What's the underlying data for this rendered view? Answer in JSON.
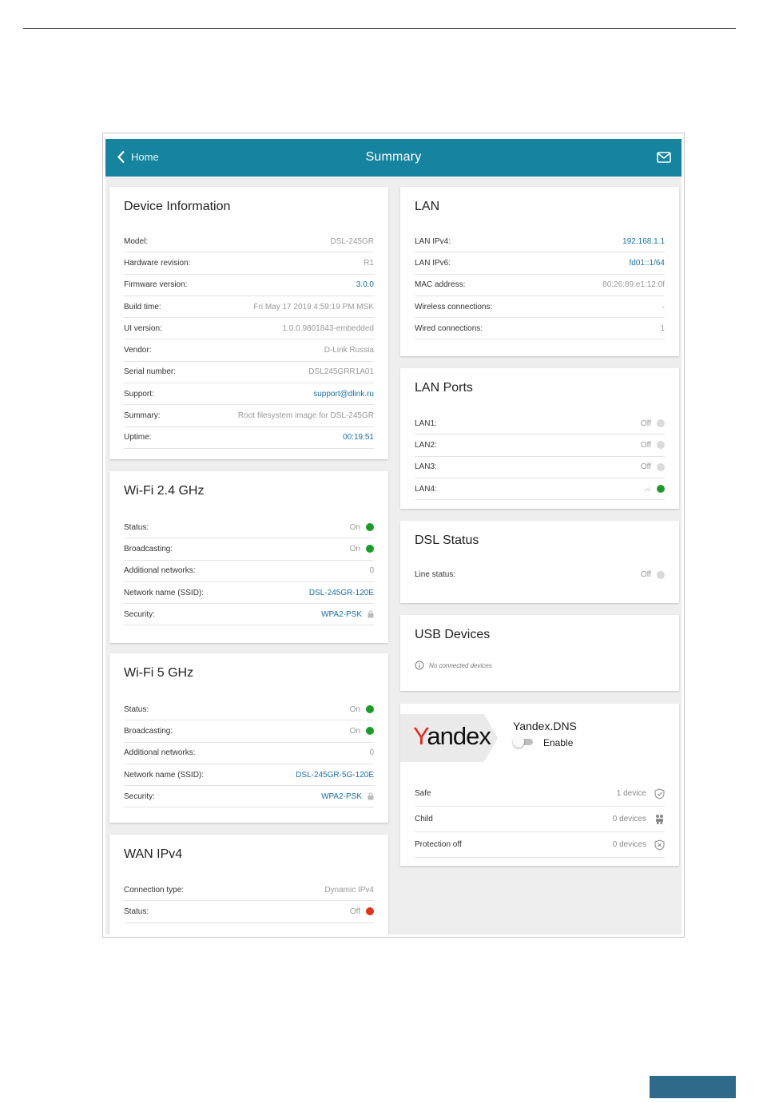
{
  "header": {
    "home_label": "Home",
    "title": "Summary"
  },
  "device_info": {
    "title": "Device Information",
    "rows": [
      {
        "label": "Model:",
        "value": "DSL-245GR"
      },
      {
        "label": "Hardware revision:",
        "value": "R1"
      },
      {
        "label": "Firmware version:",
        "value": "3.0.0"
      },
      {
        "label": "Build time:",
        "value": "Fri May 17 2019 4:59:19 PM MSK"
      },
      {
        "label": "UI version:",
        "value": "1.0.0.9801843-embedded"
      },
      {
        "label": "Vendor:",
        "value": "D-Link Russia"
      },
      {
        "label": "Serial number:",
        "value": "DSL245GRR1A01"
      },
      {
        "label": "Support:",
        "value": "support@dlink.ru"
      },
      {
        "label": "Summary:",
        "value": "Root filesystem image for DSL-245GR"
      },
      {
        "label": "Uptime:",
        "value": "00:19:51"
      }
    ]
  },
  "wifi24": {
    "title": "Wi-Fi 2.4 GHz",
    "rows": [
      {
        "label": "Status:",
        "value": "On"
      },
      {
        "label": "Broadcasting:",
        "value": "On"
      },
      {
        "label": "Additional networks:",
        "value": "0"
      },
      {
        "label": "Network name (SSID):",
        "value": "DSL-245GR-120E"
      },
      {
        "label": "Security:",
        "value": "WPA2-PSK"
      }
    ]
  },
  "wifi5": {
    "title": "Wi-Fi 5 GHz",
    "rows": [
      {
        "label": "Status:",
        "value": "On"
      },
      {
        "label": "Broadcasting:",
        "value": "On"
      },
      {
        "label": "Additional networks:",
        "value": "0"
      },
      {
        "label": "Network name (SSID):",
        "value": "DSL-245GR-5G-120E"
      },
      {
        "label": "Security:",
        "value": "WPA2-PSK"
      }
    ]
  },
  "wan": {
    "title": "WAN IPv4",
    "rows": [
      {
        "label": "Connection type:",
        "value": "Dynamic IPv4"
      },
      {
        "label": "Status:",
        "value": "Off"
      }
    ]
  },
  "lan": {
    "title": "LAN",
    "rows": [
      {
        "label": "LAN IPv4:",
        "value": "192.168.1.1"
      },
      {
        "label": "LAN IPv6:",
        "value": "fd01::1/64"
      },
      {
        "label": "MAC address:",
        "value": "80:26:89:e1:12:0f"
      },
      {
        "label": "Wireless connections:",
        "value": "-"
      },
      {
        "label": "Wired connections:",
        "value": "1"
      }
    ]
  },
  "lan_ports": {
    "title": "LAN Ports",
    "rows": [
      {
        "label": "LAN1:",
        "value": "Off"
      },
      {
        "label": "LAN2:",
        "value": "Off"
      },
      {
        "label": "LAN3:",
        "value": "Off"
      },
      {
        "label": "LAN4:",
        "value": ""
      }
    ]
  },
  "dsl": {
    "title": "DSL Status",
    "rows": [
      {
        "label": "Line status:",
        "value": "Off"
      }
    ]
  },
  "usb": {
    "title": "USB Devices",
    "note": "No connected devices"
  },
  "yandex": {
    "logo_y": "Y",
    "logo_rest": "andex",
    "title": "Yandex.DNS",
    "toggle_label": "Enable",
    "rows": [
      {
        "label": "Safe",
        "value": "1 device"
      },
      {
        "label": "Child",
        "value": "0 devices"
      },
      {
        "label": "Protection off",
        "value": "0 devices"
      }
    ]
  },
  "colors": {
    "header_bg": "#16839f",
    "status_on": "#1e9a2a",
    "status_off_red": "#e0321e",
    "status_off_grey": "#dadada",
    "link": "#1a6fa8"
  }
}
